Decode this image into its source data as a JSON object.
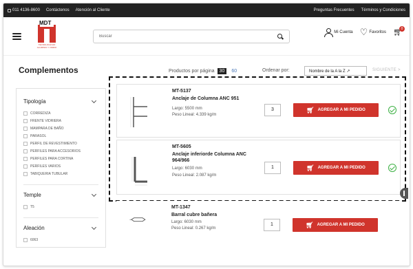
{
  "topbar": {
    "phone": "011 4136-8600",
    "links": [
      "Contáctenos",
      "Atención al Cliente"
    ],
    "right_links": [
      "Preguntas Frecuentes",
      "Términos y Condiciones"
    ]
  },
  "header": {
    "logo_text": "MDT",
    "logo_sub": "TECNOLOGÍA EN ALUMINIO Y VIDRIO",
    "search_placeholder": "Buscar",
    "account_label": "Mi Cuenta",
    "favorites_label": "Favoritos",
    "cart_count": "0"
  },
  "toolbar": {
    "title": "Complementos",
    "per_page_label": "Productos por página",
    "per_page_options": [
      "30",
      "60"
    ],
    "per_page_selected": "30",
    "order_label": "Ordenar por:",
    "order_value": "Nombre de la A la Z ↗",
    "next_label": "SIGUIENTE >"
  },
  "sidebar": {
    "groups": [
      {
        "title": "Tipología",
        "items": [
          "CORREDIZA",
          "FRENTE VIDRIERA",
          "MAMPARA DE BAÑO",
          "PARASOL",
          "PERFIL DE REVESTIMIENTO",
          "PERFILES PARA ACCESORIOS",
          "PERFILES PARA CORTINA",
          "PERFILES VARIOS",
          "TABIQUERIA TUBULAR"
        ]
      },
      {
        "title": "Temple",
        "items": [
          "T5"
        ]
      },
      {
        "title": "Aleación",
        "items": [
          "6063"
        ]
      }
    ]
  },
  "products": [
    {
      "code": "MT-5137",
      "name": "Anclaje de Columna ANC 951",
      "length": "Largo: 5500 mm",
      "weight": "Peso Lineal: 4.339 kg/m",
      "qty": "3",
      "button": "AGREGAR A MI PEDIDO",
      "added": true
    },
    {
      "code": "MT-5605",
      "name": "Anclaje inferiorde Columna ANC 964/966",
      "length": "Largo: 6030 mm",
      "weight": "Peso Lineal: 2.087 kg/m",
      "qty": "1",
      "button": "AGREGAR A MI PEDIDO",
      "added": true
    },
    {
      "code": "MT-1347",
      "name": "Barral cubre bañera",
      "length": "Largo: 6030 mm",
      "weight": "Peso Lineal: 0.267 kg/m",
      "qty": "1",
      "button": "AGREGAR A MI PEDIDO",
      "added": false
    }
  ],
  "colors": {
    "accent": "#d0342c",
    "success": "#3cb043",
    "topbar": "#222222"
  }
}
